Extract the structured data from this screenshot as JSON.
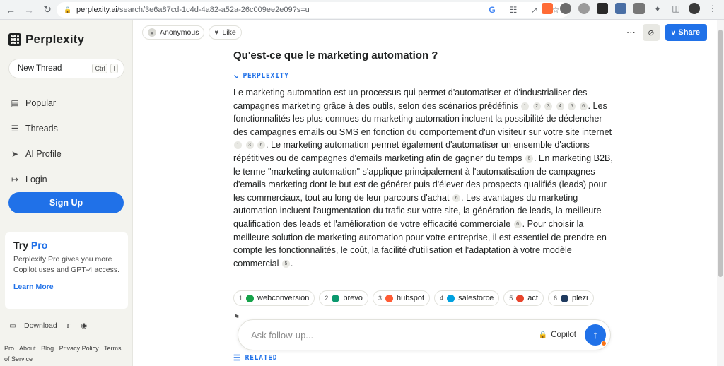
{
  "browser": {
    "url_host": "perplexity.ai",
    "url_path": "/search/3e6a87cd-1c4d-4a82-a52a-26c009ee2e09?s=u"
  },
  "sidebar": {
    "logo_text": "Perplexity",
    "new_thread": {
      "label": "New Thread",
      "kbd_ctrl": "Ctrl",
      "kbd_key": "I"
    },
    "nav": [
      {
        "label": "Popular",
        "icon": "popular-icon"
      },
      {
        "label": "Threads",
        "icon": "threads-icon"
      },
      {
        "label": "AI Profile",
        "icon": "send-icon"
      },
      {
        "label": "Login",
        "icon": "login-icon"
      }
    ],
    "signup_label": "Sign Up",
    "pro_card": {
      "title_try": "Try",
      "title_pro": "Pro",
      "description": "Perplexity Pro gives you more Copilot uses and GPT-4 access.",
      "learn_more": "Learn More"
    },
    "footer": {
      "download": "Download"
    },
    "links": [
      "Pro",
      "About",
      "Blog",
      "Privacy Policy",
      "Terms of Service"
    ]
  },
  "header": {
    "author": "Anonymous",
    "like": "Like",
    "share": "Share"
  },
  "thread": {
    "question": "Qu'est-ce que le marketing automation ?",
    "source_label": "PERPLEXITY",
    "answer_parts": [
      "Le marketing automation est un processus qui permet d'automatiser et d'industrialiser des campagnes marketing grâce à des outils, selon des scénarios prédéfinis",
      ". Les fonctionnalités les plus connues du marketing automation incluent la possibilité de déclencher des campagnes emails ou SMS en fonction du comportement d'un visiteur sur votre site internet",
      ". Le marketing automation permet également d'automatiser un ensemble d'actions répétitives ou de campagnes d'emails marketing afin de gagner du temps",
      ". En marketing B2B, le terme \"marketing automation\" s'applique principalement à l'automatisation de campagnes d'emails marketing dont le but est de générer puis d'élever des prospects qualifiés (leads) pour les commerciaux, tout au long de leur parcours d'achat",
      ". Les avantages du marketing automation incluent l'augmentation du trafic sur votre site, la génération de leads, la meilleure qualification des leads et l'amélioration de votre efficacité commerciale",
      ". Pour choisir la meilleure solution de marketing automation pour votre entreprise, il est essentiel de prendre en compte les fonctionnalités, le coût, la facilité d'utilisation et l'adaptation à votre modèle commercial",
      "."
    ],
    "citations": [
      [
        "1",
        "2",
        "3",
        "4",
        "5",
        "6"
      ],
      [
        "1",
        "3",
        "6"
      ],
      [
        "6"
      ],
      [
        "6"
      ],
      [
        "6"
      ],
      [
        "5"
      ]
    ],
    "sources": [
      {
        "num": "1",
        "name": "webconversion",
        "color": "#16a34a"
      },
      {
        "num": "2",
        "name": "brevo",
        "color": "#0b996e"
      },
      {
        "num": "3",
        "name": "hubspot",
        "color": "#ff5c35"
      },
      {
        "num": "4",
        "name": "salesforce",
        "color": "#00a1e0"
      },
      {
        "num": "5",
        "name": "act",
        "color": "#e8452c"
      },
      {
        "num": "6",
        "name": "plezi",
        "color": "#1f3a5f"
      }
    ],
    "related_label": "RELATED"
  },
  "ask": {
    "placeholder": "Ask follow-up...",
    "copilot": "Copilot"
  }
}
